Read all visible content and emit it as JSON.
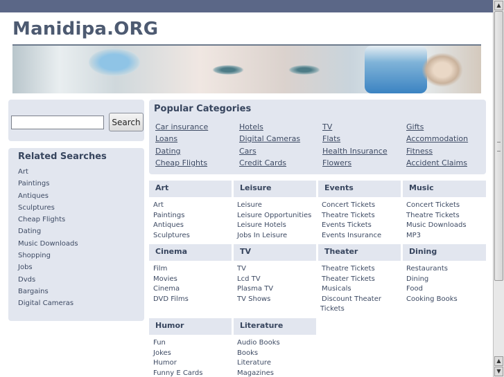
{
  "site": {
    "title": "Manidipa.ORG"
  },
  "search": {
    "value": "",
    "button_label": "Search"
  },
  "related": {
    "title": "Related Searches",
    "items": [
      "Art",
      "Paintings",
      "Antiques",
      "Sculptures",
      "Cheap Flights",
      "Dating",
      "Music Downloads",
      "Shopping",
      "Jobs",
      "Dvds",
      "Bargains",
      "Digital Cameras"
    ]
  },
  "popular": {
    "title": "Popular Categories",
    "items": [
      "Car insurance",
      "Hotels",
      "TV",
      "Gifts",
      "Loans",
      "Digital Cameras",
      "Flats",
      "Accommodation",
      "Dating",
      "Cars",
      "Health Insurance",
      "Fitness",
      "Cheap Flights",
      "Credit Cards",
      "Flowers",
      "Accident Claims"
    ]
  },
  "categories": [
    {
      "title": "Art",
      "links": [
        "Art",
        "Paintings",
        "Antiques",
        "Sculptures"
      ]
    },
    {
      "title": "Leisure",
      "links": [
        "Leisure",
        "Leisure Opportunities",
        "Leisure Hotels",
        "Jobs In Leisure"
      ]
    },
    {
      "title": "Events",
      "links": [
        "Concert Tickets",
        "Theatre Tickets",
        "Events Tickets",
        "Events Insurance"
      ]
    },
    {
      "title": "Music",
      "links": [
        "Concert Tickets",
        "Theatre Tickets",
        "Music Downloads",
        "MP3"
      ]
    },
    {
      "title": "Cinema",
      "links": [
        "Film",
        "Movies",
        "Cinema",
        "DVD Films"
      ]
    },
    {
      "title": "TV",
      "links": [
        "TV",
        "Lcd TV",
        "Plasma TV",
        "TV Shows"
      ]
    },
    {
      "title": "Theater",
      "links": [
        "Theatre Tickets",
        "Theater Tickets",
        "Musicals",
        "Discount Theater",
        "Tickets"
      ]
    },
    {
      "title": "Dining",
      "links": [
        "Restaurants",
        "Dining",
        "Food",
        "Cooking Books"
      ]
    },
    {
      "title": "Humor",
      "links": [
        "Fun",
        "Jokes",
        "Humor",
        "Funny E Cards"
      ]
    },
    {
      "title": "Literature",
      "links": [
        "Audio Books",
        "Books",
        "Literature",
        "Magazines"
      ]
    }
  ],
  "icons": {
    "scroll_up": "arrow-up-icon",
    "scroll_down": "arrow-down-icon"
  }
}
